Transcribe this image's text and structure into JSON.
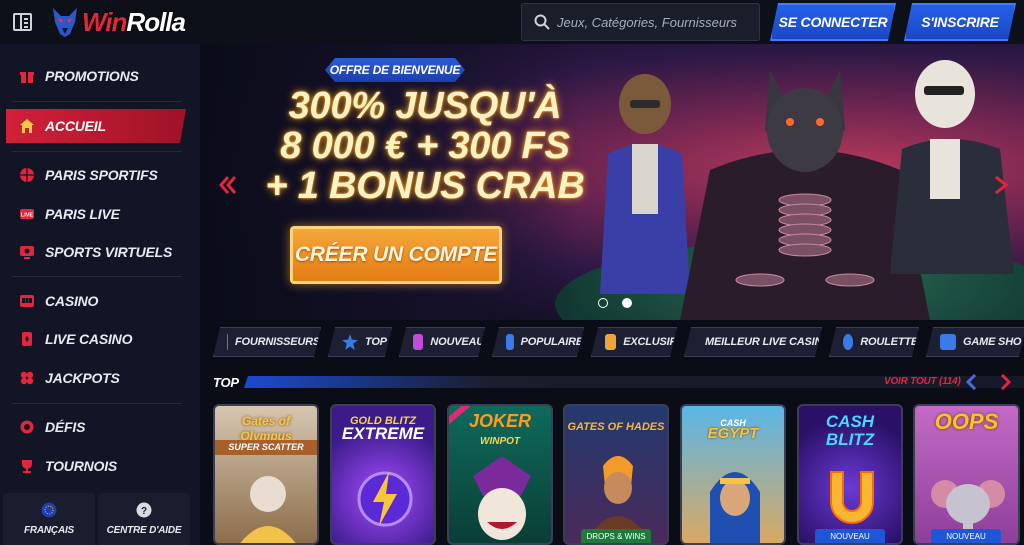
{
  "header": {
    "logo_text_red": "Win",
    "logo_text_white": "Rolla",
    "search_placeholder": "Jeux, Catégories, Fournisseurs",
    "login_label": "SE CONNECTER",
    "signup_label": "S'INSCRIRE"
  },
  "sidebar": {
    "items": [
      {
        "label": "PROMOTIONS",
        "icon": "gift-icon"
      },
      {
        "label": "ACCUEIL",
        "icon": "home-icon",
        "active": true
      },
      {
        "label": "PARIS SPORTIFS",
        "icon": "basketball-icon"
      },
      {
        "label": "PARIS LIVE",
        "icon": "live-icon"
      },
      {
        "label": "SPORTS VIRTUELS",
        "icon": "virtual-sports-icon"
      },
      {
        "label": "CASINO",
        "icon": "slot-machine-icon"
      },
      {
        "label": "LIVE CASINO",
        "icon": "cards-icon"
      },
      {
        "label": "JACKPOTS",
        "icon": "clover-icon"
      },
      {
        "label": "DÉFIS",
        "icon": "challenge-icon"
      },
      {
        "label": "TOURNOIS",
        "icon": "trophy-icon"
      }
    ],
    "language_label": "FRANÇAIS",
    "help_label": "CENTRE D'AIDE"
  },
  "hero": {
    "offer_tag": "OFFRE DE BIENVENUE",
    "title_line1": "300% JUSQU'À",
    "title_line2": "8 000 € + 300 FS",
    "title_line3": "+ 1 BONUS CRAB",
    "cta_label": "CRÉER UN COMPTE",
    "slides_count": 2,
    "active_slide": 2
  },
  "categories": [
    {
      "label": "FOURNISSEURS",
      "icon": "providers-icon",
      "color": "#3c7ae8"
    },
    {
      "label": "TOP",
      "icon": "star-icon",
      "color": "#3c7ae8"
    },
    {
      "label": "NOUVEAU",
      "icon": "new-icon",
      "color": "#c24bd8"
    },
    {
      "label": "POPULAIRE",
      "icon": "popular-icon",
      "color": "#3c7ae8"
    },
    {
      "label": "EXCLUSIF",
      "icon": "exclusive-icon",
      "color": "#f2a23a"
    },
    {
      "label": "MEILLEUR LIVE CASINO",
      "icon": "live-casino-icon",
      "color": "#3c7ae8"
    },
    {
      "label": "ROULETTE",
      "icon": "roulette-icon",
      "color": "#3c7ae8"
    },
    {
      "label": "GAME SHO",
      "icon": "game-show-icon",
      "color": "#3c7ae8"
    }
  ],
  "top_section": {
    "title": "TOP",
    "see_all": "VOIR TOUT (114)"
  },
  "games": [
    {
      "title": "Gates of Olympus",
      "sub": "SUPER SCATTER",
      "bg": "#c9b7a0",
      "accent": "#f3c94a",
      "badge": ""
    },
    {
      "title": "GOLD BLITZ",
      "sub": "EXTREME",
      "bg": "#3b1b8a",
      "accent": "#ffffff",
      "badge": ""
    },
    {
      "title": "JOKER",
      "sub": "WINPOT",
      "bg": "#0d5a4f",
      "accent": "#ff9b1f",
      "badge": ""
    },
    {
      "title": "GATES OF HADES",
      "sub": "",
      "bg": "#1f3463",
      "accent": "#f6b63a",
      "badge": "DROPS & WINS"
    },
    {
      "title": "CASH",
      "sub": "EGYPT",
      "bg": "#3c9ad4",
      "accent": "#f4c442",
      "badge": ""
    },
    {
      "title": "CASH",
      "sub": "BLITZ",
      "bg": "#3a1a86",
      "accent": "#f7b733",
      "badge": "NOUVEAU"
    },
    {
      "title": "OOPS",
      "sub": "",
      "bg": "#b85ab8",
      "accent": "#f7c52a",
      "badge": "NOUVEAU"
    }
  ],
  "colors": {
    "brand_red": "#e2263b",
    "brand_blue": "#2461e8",
    "cta_orange": "#f5a73a"
  }
}
